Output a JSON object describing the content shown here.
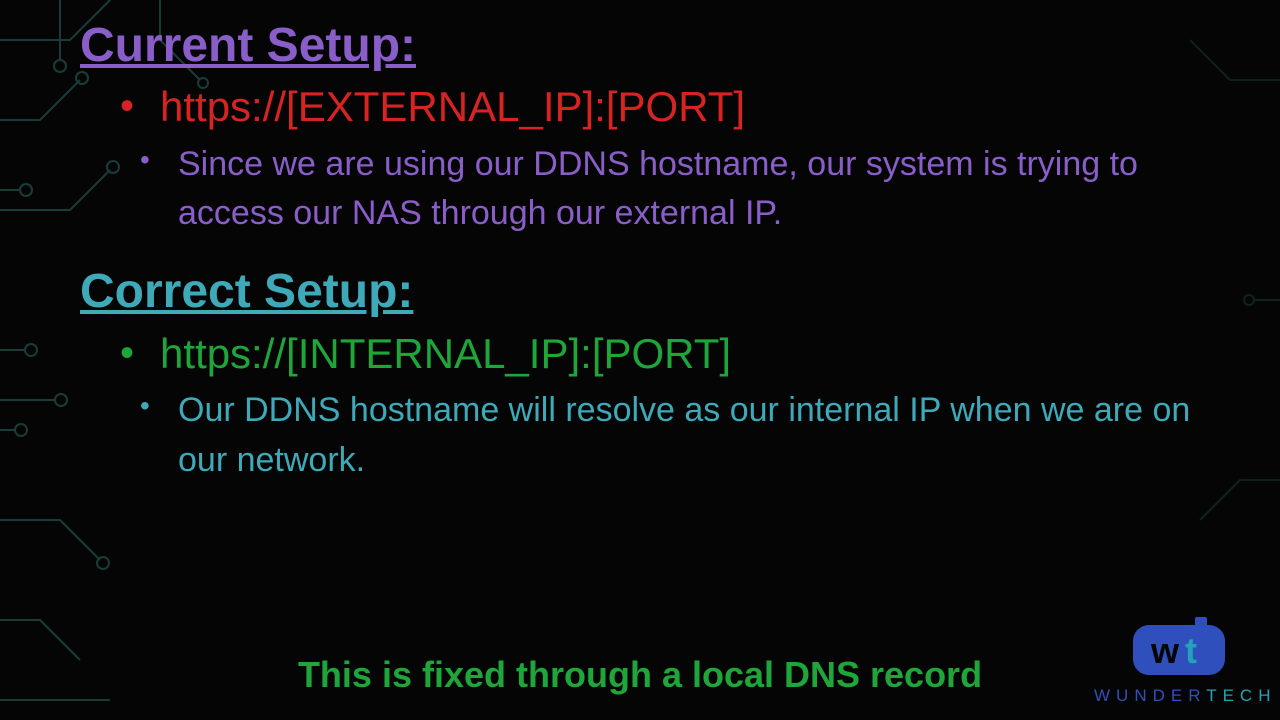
{
  "current": {
    "heading": "Current Setup:",
    "url": "https://[EXTERNAL_IP]:[PORT]",
    "description": "Since we are using our DDNS hostname, our system is trying to access our NAS through our external IP."
  },
  "correct": {
    "heading": "Correct Setup:",
    "url": "https://[INTERNAL_IP]:[PORT]",
    "description": "Our DDNS hostname will resolve as our internal IP when we are on our network."
  },
  "footer": "This is fixed through a local DNS record",
  "logo": {
    "wunder": "WUNDER",
    "tech": "TECH"
  }
}
